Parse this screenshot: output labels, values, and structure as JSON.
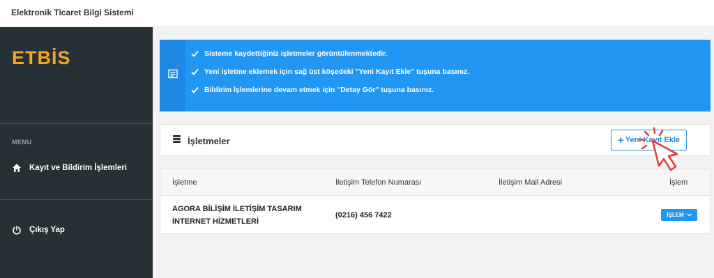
{
  "header": {
    "app_title": "Elektronik Ticaret Bilgi Sistemi"
  },
  "sidebar": {
    "logo": "ETBİS",
    "menu_header": "MENU",
    "items": [
      {
        "label": "Kayıt ve Bildirim İşlemleri",
        "icon": "home-icon"
      },
      {
        "label": "Çıkış Yap",
        "icon": "power-icon"
      }
    ]
  },
  "info": {
    "icon": "list-icon",
    "lines": [
      "Sisteme kaydettiğiniz işletmeler görüntülenmektedir.",
      "Yeni işletme eklemek için sağ üst köşedeki \"Yeni Kayıt Ekle\" tuşuna basınız.",
      "Bildirim İşlemlerine devam etmek için \"Detay Gör\" tuşuna basınız."
    ]
  },
  "panel": {
    "title": "İşletmeler",
    "icon": "database-icon",
    "add_button": "Yeni Kayıt Ekle"
  },
  "table": {
    "columns": [
      "İşletme",
      "İletişim Telefon Numarası",
      "İletişim Mail Adresi",
      "İşlem"
    ],
    "rows": [
      {
        "name_line1": "AGORA BİLİŞİM İLETİŞİM TASARIM",
        "name_line2": "İNTERNET HİZMETLERİ",
        "phone": "(0216) 456 7422",
        "mail": "",
        "action": "İŞLEM"
      }
    ]
  },
  "colors": {
    "accent": "#2196f3",
    "sidebar": "#263035",
    "logo": "#f4a522",
    "pointer": "#e53935"
  }
}
